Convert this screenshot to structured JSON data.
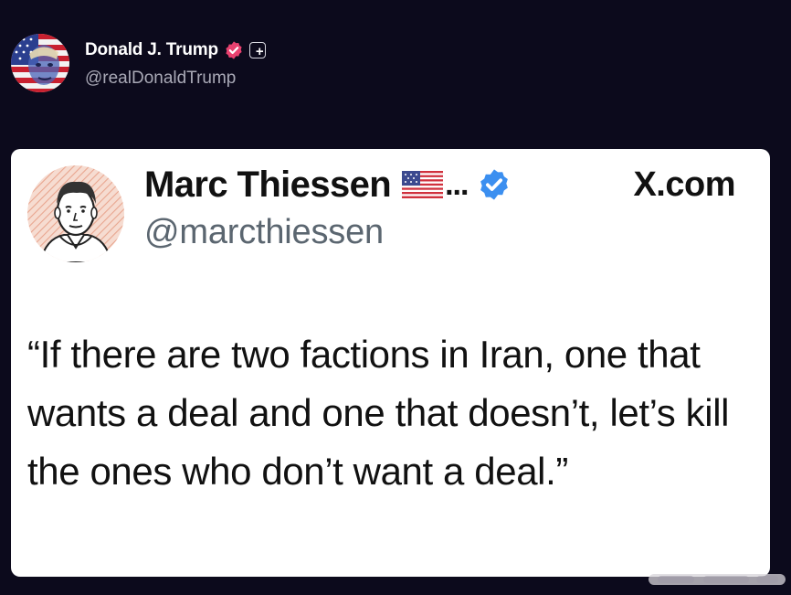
{
  "post": {
    "author_name": "Donald J. Trump",
    "author_handle": "@realDonaldTrump",
    "avatar_icon": "flag-portrait-avatar",
    "verified_badge_color": "#e8416f",
    "plus_label": "+"
  },
  "embed": {
    "author_name": "Marc Thiessen",
    "name_ellipsis": "...",
    "author_handle": "@marcthiessen",
    "source_label": "X.com",
    "verified_color": "#3b8ff0",
    "quote": "“If there are two factions in Iran, one that wants a deal and one that doesn’t, let’s kill the ones who don’t want a deal.”"
  },
  "colors": {
    "background": "#0c0a1c",
    "card": "#ffffff",
    "handle_gray": "#a9a9b6",
    "embed_handle_gray": "#5b6670"
  }
}
